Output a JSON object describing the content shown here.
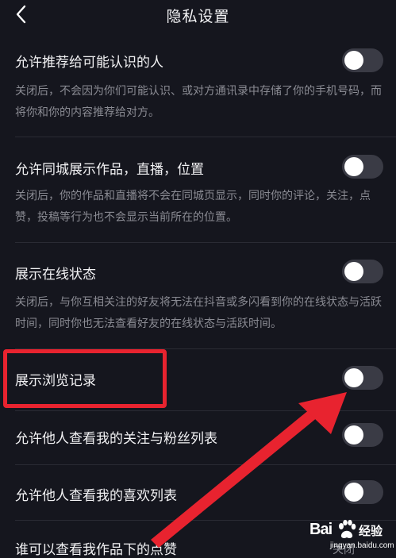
{
  "header": {
    "title": "隐私设置",
    "back_icon": "chevron-left-icon"
  },
  "settings": [
    {
      "label": "允许推荐给可能认识的人",
      "description": "关闭后，不会因为你们可能认识、或对方通讯录中存储了你的手机号码，而将你和你的内容推荐给对方。",
      "enabled": false
    },
    {
      "label": "允许同城展示作品，直播，位置",
      "description": "关闭后，你的作品和直播将不会在同城页显示，同时你的评论，关注，点赞，投稿等行为也不会显示当前所在的位置。",
      "enabled": false
    },
    {
      "label": "展示在线状态",
      "description": "关闭后，与你互相关注的好友将无法在抖音或多闪看到你的在线状态与活跃时间，同时你也无法查看好友的在线状态与活跃时间。",
      "enabled": false
    },
    {
      "label": "展示浏览记录",
      "enabled": false
    },
    {
      "label": "允许他人查看我的关注与粉丝列表",
      "enabled": false
    },
    {
      "label": "允许他人查看我的喜欢列表",
      "enabled": false
    },
    {
      "label": "谁可以查看我作品下的点赞",
      "value": "关闭"
    }
  ],
  "annotation": {
    "highlight_color": "#e8232f"
  },
  "watermark": {
    "brand": "Bai",
    "paw_icon": "baidu-paw-icon",
    "brand_suffix": "经验",
    "url": "jingyan.baidu.com"
  },
  "colors": {
    "background": "#15161e",
    "toggle_off": "#3a3b45",
    "description": "#8a8b93"
  }
}
